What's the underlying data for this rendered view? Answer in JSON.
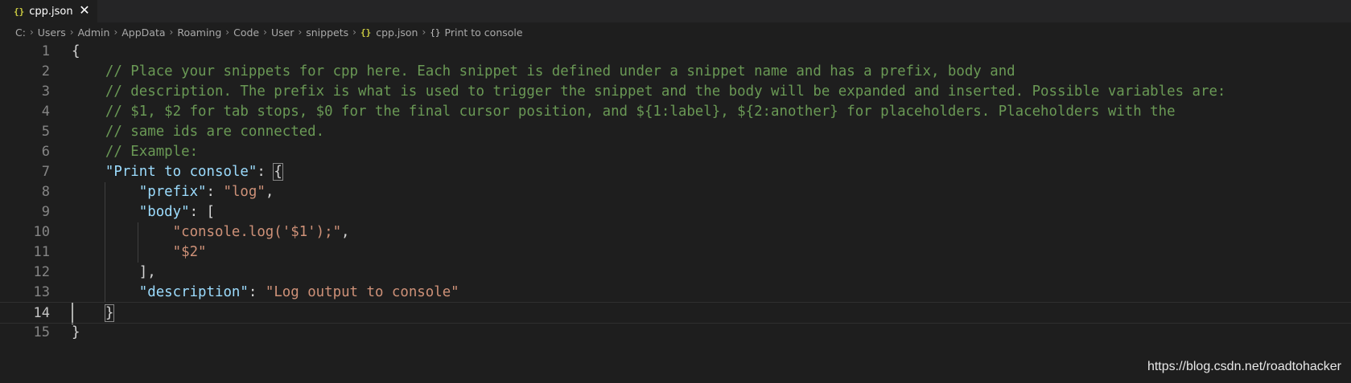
{
  "tab": {
    "icon": "{}",
    "label": "cpp.json",
    "close": "✕"
  },
  "breadcrumb": {
    "items": [
      "C:",
      "Users",
      "Admin",
      "AppData",
      "Roaming",
      "Code",
      "User",
      "snippets"
    ],
    "file_icon": "{}",
    "file": "cpp.json",
    "symbol_icon": "{}",
    "symbol": "Print to console",
    "separator": "›"
  },
  "editor": {
    "current_line": 14,
    "lines": [
      {
        "n": "1",
        "tokens": [
          {
            "t": "{",
            "k": "punc"
          }
        ]
      },
      {
        "n": "2",
        "tokens": [
          {
            "t": "    // Place your snippets for cpp here. Each snippet is defined under a snippet name and has a prefix, body and",
            "k": "comment"
          }
        ]
      },
      {
        "n": "3",
        "tokens": [
          {
            "t": "    // description. The prefix is what is used to trigger the snippet and the body will be expanded and inserted. Possible variables are:",
            "k": "comment"
          }
        ]
      },
      {
        "n": "4",
        "tokens": [
          {
            "t": "    // $1, $2 for tab stops, $0 for the final cursor position, and ${1:label}, ${2:another} for placeholders. Placeholders with the",
            "k": "comment"
          }
        ]
      },
      {
        "n": "5",
        "tokens": [
          {
            "t": "    // same ids are connected.",
            "k": "comment"
          }
        ]
      },
      {
        "n": "6",
        "tokens": [
          {
            "t": "    // Example:",
            "k": "comment"
          }
        ]
      },
      {
        "n": "7",
        "tokens": [
          {
            "t": "    ",
            "k": "punc"
          },
          {
            "t": "\"Print to console\"",
            "k": "key"
          },
          {
            "t": ": ",
            "k": "punc"
          },
          {
            "t": "{",
            "k": "match"
          }
        ]
      },
      {
        "n": "8",
        "tokens": [
          {
            "t": "        ",
            "k": "punc"
          },
          {
            "t": "\"prefix\"",
            "k": "key"
          },
          {
            "t": ": ",
            "k": "punc"
          },
          {
            "t": "\"log\"",
            "k": "str"
          },
          {
            "t": ",",
            "k": "punc"
          }
        ]
      },
      {
        "n": "9",
        "tokens": [
          {
            "t": "        ",
            "k": "punc"
          },
          {
            "t": "\"body\"",
            "k": "key"
          },
          {
            "t": ": [",
            "k": "punc"
          }
        ]
      },
      {
        "n": "10",
        "tokens": [
          {
            "t": "            ",
            "k": "punc"
          },
          {
            "t": "\"console.log('$1');\"",
            "k": "str"
          },
          {
            "t": ",",
            "k": "punc"
          }
        ]
      },
      {
        "n": "11",
        "tokens": [
          {
            "t": "            ",
            "k": "punc"
          },
          {
            "t": "\"$2\"",
            "k": "str"
          }
        ]
      },
      {
        "n": "12",
        "tokens": [
          {
            "t": "        ],",
            "k": "punc"
          }
        ]
      },
      {
        "n": "13",
        "tokens": [
          {
            "t": "        ",
            "k": "punc"
          },
          {
            "t": "\"description\"",
            "k": "key"
          },
          {
            "t": ": ",
            "k": "punc"
          },
          {
            "t": "\"Log output to console\"",
            "k": "str"
          }
        ]
      },
      {
        "n": "14",
        "tokens": [
          {
            "t": "    ",
            "k": "punc"
          },
          {
            "t": "}",
            "k": "match"
          }
        ]
      },
      {
        "n": "15",
        "tokens": [
          {
            "t": "}",
            "k": "punc"
          }
        ]
      }
    ]
  },
  "watermark": "https://blog.csdn.net/roadtohacker"
}
